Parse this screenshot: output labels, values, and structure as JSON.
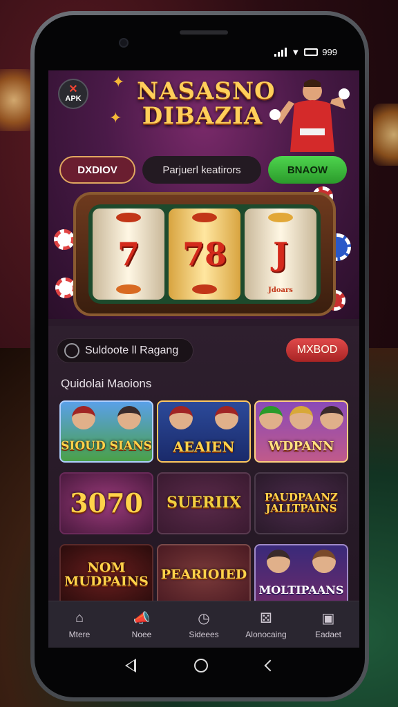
{
  "status_bar": {
    "time": "999"
  },
  "app": {
    "badge": "APK",
    "title_line1": "NASASNO",
    "title_line2": "DIBAZIA"
  },
  "hero_buttons": {
    "left": "DXDIOV",
    "middle": "Parjuerl keatirors",
    "right": "BNAOW"
  },
  "slot": {
    "reels": [
      "7",
      "78",
      "J"
    ],
    "reel_caption": "Jdoars"
  },
  "search": {
    "placeholder": "Suldoote ll Ragang"
  },
  "action_button": "MXBOD",
  "section_title": "Quidolai Maoions",
  "games": [
    {
      "label": "SIOUD SIANS"
    },
    {
      "label": "AEAIEN"
    },
    {
      "label": "WDPANN"
    },
    {
      "label": "3070"
    },
    {
      "label": "SUERIIX"
    },
    {
      "label": "PAUDPAANZ JALLTPAINS"
    },
    {
      "label": "NOM MUDPAINS"
    },
    {
      "label": "PEARIOIED"
    },
    {
      "label": "MOLTIPAANS"
    }
  ],
  "bottom_nav": [
    {
      "label": "Mtere",
      "icon": "home-icon"
    },
    {
      "label": "Noee",
      "icon": "megaphone-icon"
    },
    {
      "label": "Sideees",
      "icon": "clock-icon"
    },
    {
      "label": "Alonocaing",
      "icon": "dice-icon"
    },
    {
      "label": "Eadaet",
      "icon": "treasure-icon"
    }
  ],
  "colors": {
    "accent_green": "#3cc13c",
    "accent_red": "#c23030",
    "title_gold": "#ffcf5a"
  }
}
